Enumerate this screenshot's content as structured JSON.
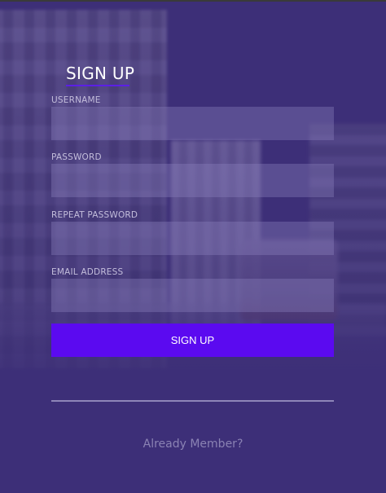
{
  "form": {
    "title": "SIGN UP",
    "fields": [
      {
        "label": "USERNAME",
        "value": "",
        "placeholder": ""
      },
      {
        "label": "PASSWORD",
        "value": "",
        "placeholder": ""
      },
      {
        "label": "REPEAT PASSWORD",
        "value": "",
        "placeholder": ""
      },
      {
        "label": "EMAIL ADDRESS",
        "value": "",
        "placeholder": ""
      }
    ],
    "submit_label": "SIGN UP",
    "member_link": "Already Member?"
  },
  "colors": {
    "background": "#3d2f78",
    "accent": "#5b0af0",
    "title_underline": "#5b1fe6"
  }
}
